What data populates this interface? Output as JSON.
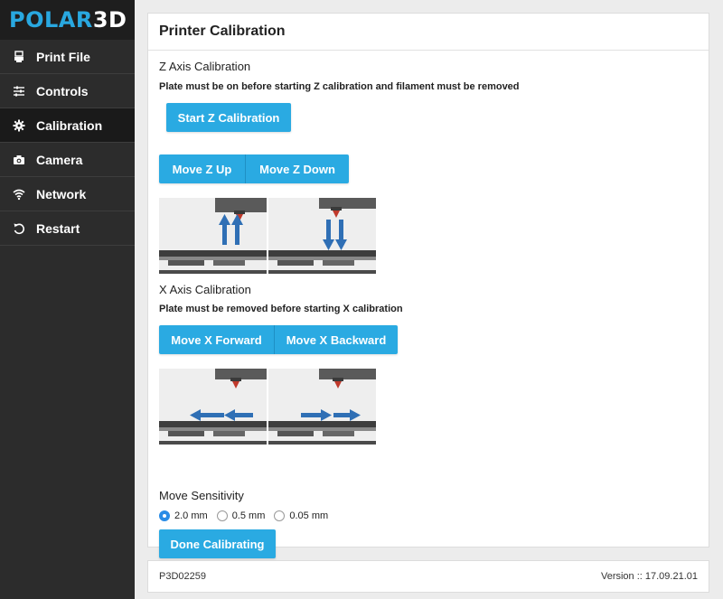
{
  "logo": {
    "part1": "POLAR",
    "part2": "3D"
  },
  "sidebar": {
    "items": [
      {
        "label": "Print File",
        "icon": "printer-icon"
      },
      {
        "label": "Controls",
        "icon": "sliders-icon"
      },
      {
        "label": "Calibration",
        "icon": "gear-icon",
        "active": true
      },
      {
        "label": "Camera",
        "icon": "camera-icon"
      },
      {
        "label": "Network",
        "icon": "wifi-icon"
      },
      {
        "label": "Restart",
        "icon": "restart-icon"
      }
    ]
  },
  "panel": {
    "title": "Printer Calibration",
    "z_axis": {
      "title": "Z Axis Calibration",
      "note": "Plate must be on before starting Z calibration and filament must be removed",
      "start_button": "Start Z Calibration",
      "move_up": "Move Z Up",
      "move_down": "Move Z Down"
    },
    "x_axis": {
      "title": "X Axis Calibration",
      "note": "Plate must be removed before starting X calibration",
      "move_forward": "Move X Forward",
      "move_backward": "Move X Backward"
    },
    "sensitivity": {
      "title": "Move Sensitivity",
      "options": [
        "2.0 mm",
        "0.5 mm",
        "0.05 mm"
      ],
      "selected": "2.0 mm"
    },
    "done_button": "Done Calibrating"
  },
  "footer": {
    "device_id": "P3D02259",
    "version": "Version :: 17.09.21.01"
  },
  "colors": {
    "accent": "#2aaae2",
    "sidebar_bg": "#2c2c2c",
    "arrow": "#2f6fb5"
  }
}
